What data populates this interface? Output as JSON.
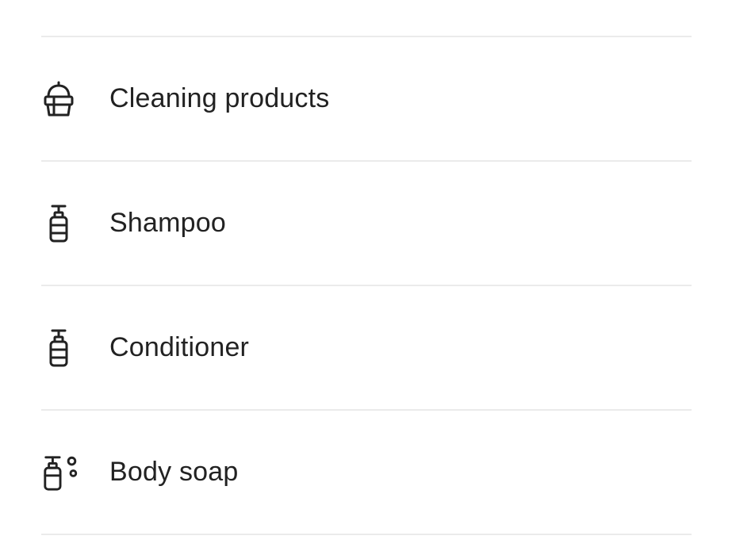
{
  "amenities": {
    "items": [
      {
        "label": "Cleaning products",
        "icon": "cleaning-products-icon"
      },
      {
        "label": "Shampoo",
        "icon": "shampoo-bottle-icon"
      },
      {
        "label": "Conditioner",
        "icon": "conditioner-bottle-icon"
      },
      {
        "label": "Body soap",
        "icon": "body-soap-icon"
      }
    ]
  },
  "colors": {
    "text": "#222222",
    "divider": "#ebebeb",
    "background": "#ffffff"
  }
}
